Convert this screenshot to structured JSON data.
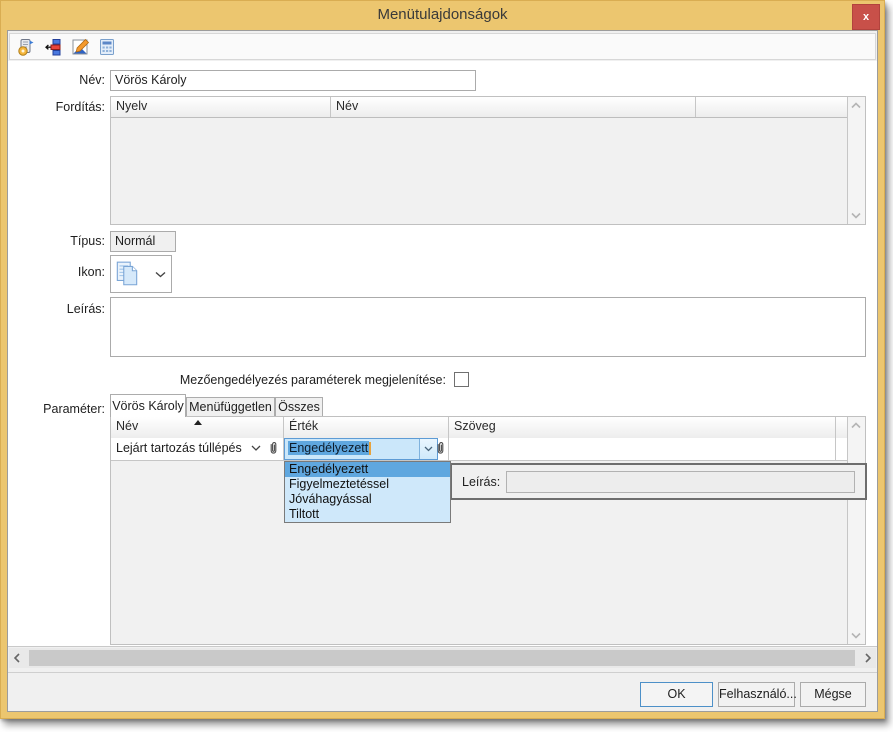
{
  "window": {
    "title": "Menütulajdonságok",
    "close_label": "x"
  },
  "toolbar": {
    "icons": [
      {
        "name": "script-settings-icon"
      },
      {
        "name": "reorder-icon"
      },
      {
        "name": "edit-icon"
      },
      {
        "name": "calculator-icon"
      }
    ]
  },
  "form": {
    "nev": {
      "label": "Név:",
      "value": "Vörös Károly"
    },
    "forditas": {
      "label": "Fordítás:",
      "columns": [
        "Nyelv",
        "Név"
      ],
      "rows": []
    },
    "tipus": {
      "label": "Típus:",
      "value": "Normál"
    },
    "ikon": {
      "label": "Ikon:"
    },
    "leiras": {
      "label": "Leírás:",
      "value": ""
    },
    "mezo_checkbox": {
      "label": "Mezőengedélyezés paraméterek megjelenítése:",
      "checked": false
    },
    "parameter": {
      "label": "Paraméter:",
      "tabs": [
        {
          "label": "Vörös Károly",
          "active": true
        },
        {
          "label": "Menüfüggetlen",
          "active": false
        },
        {
          "label": "Összes",
          "active": false
        }
      ],
      "table": {
        "columns": [
          "Név",
          "Érték",
          "Szöveg"
        ],
        "sort_column": "Név",
        "sort_direction": "asc",
        "rows": [
          {
            "nev": "Lejárt tartozás túllépés",
            "ertek": "Engedélyezett",
            "szoveg": ""
          }
        ]
      },
      "dropdown": {
        "options": [
          "Engedélyezett",
          "Figyelmeztetéssel",
          "Jóváhagyással",
          "Tiltott"
        ],
        "selected": "Engedélyezett"
      },
      "leiras_panel": {
        "label": "Leírás:",
        "value": ""
      }
    }
  },
  "footer": {
    "buttons": [
      {
        "label": "OK",
        "default": true
      },
      {
        "label": "Felhasználó...",
        "default": false
      },
      {
        "label": "Mégse",
        "default": false
      }
    ]
  },
  "colors": {
    "frame_gold": "#ecc66f",
    "close_red": "#c85049",
    "selection_blue": "#5fa7df",
    "popup_blue": "#cfe8fa",
    "combo_border_blue": "#5d9bd5"
  }
}
